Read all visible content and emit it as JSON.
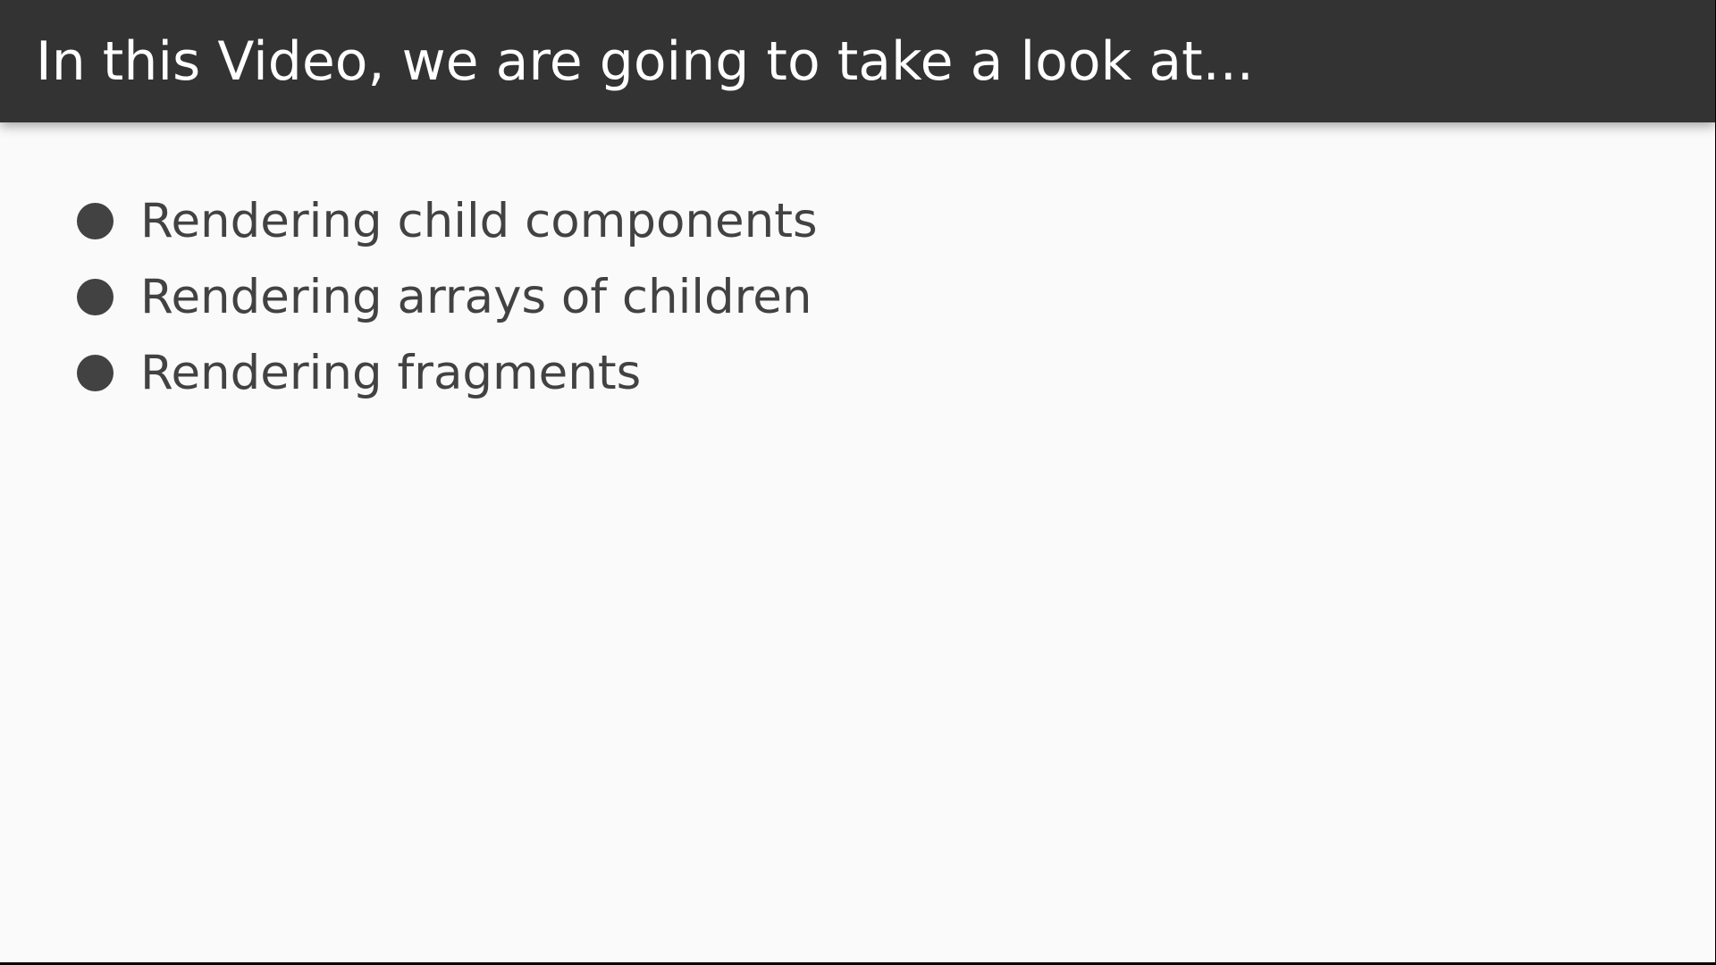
{
  "slide": {
    "title": "In this Video, we are going to take a look at...",
    "bullets": [
      {
        "label": "Rendering child components"
      },
      {
        "label": "Rendering arrays of children"
      },
      {
        "label": "Rendering fragments"
      }
    ]
  },
  "colors": {
    "title_bar": "#333333",
    "title_text": "#ffffff",
    "background": "#fafafa",
    "body_text": "#424242"
  }
}
